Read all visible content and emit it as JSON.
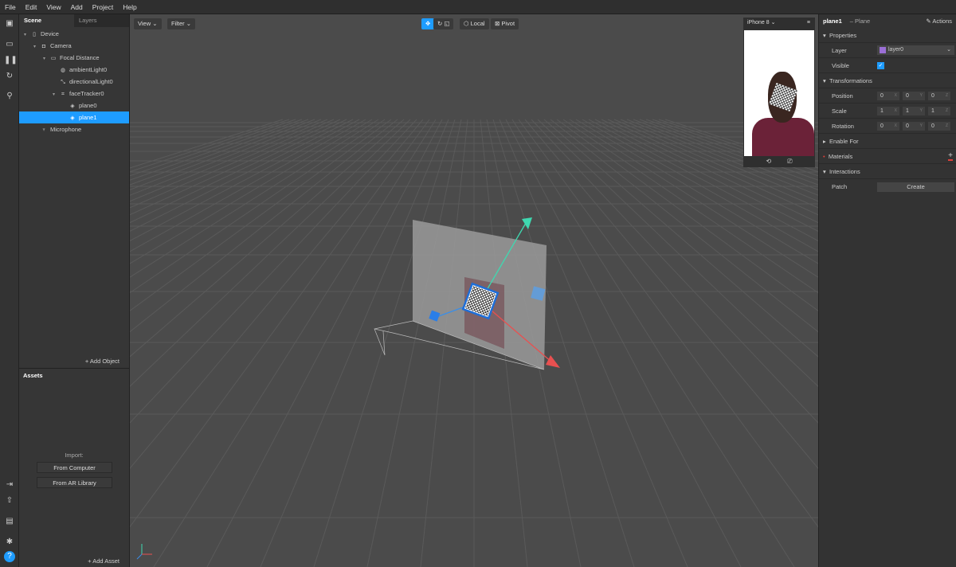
{
  "menu": [
    "File",
    "Edit",
    "View",
    "Add",
    "Project",
    "Help"
  ],
  "scene": {
    "tabs": [
      "Scene",
      "Layers"
    ],
    "tree": [
      {
        "label": "Device",
        "icon": "device-icon",
        "depth": 0,
        "arrow": true
      },
      {
        "label": "Camera",
        "icon": "camera-icon",
        "depth": 1,
        "arrow": true
      },
      {
        "label": "Focal Distance",
        "icon": "focal-distance-icon",
        "depth": 2,
        "arrow": true
      },
      {
        "label": "ambientLight0",
        "icon": "ambient-light-icon",
        "depth": 3,
        "arrow": false
      },
      {
        "label": "directionalLight0",
        "icon": "directional-light-icon",
        "depth": 3,
        "arrow": false
      },
      {
        "label": "faceTracker0",
        "icon": "face-tracker-icon",
        "depth": 3,
        "arrow": true
      },
      {
        "label": "plane0",
        "icon": "plane-icon",
        "depth": 4,
        "arrow": false
      },
      {
        "label": "plane1",
        "icon": "plane-icon",
        "depth": 4,
        "arrow": false,
        "selected": true
      },
      {
        "label": "Microphone",
        "icon": "microphone-icon",
        "depth": 1,
        "arrow": false
      }
    ],
    "add_object": "+  Add Object"
  },
  "assets": {
    "title": "Assets",
    "import": "Import:",
    "from_computer": "From Computer",
    "from_library": "From AR Library",
    "add_asset": "+  Add Asset"
  },
  "viewport": {
    "view": "View ⌄",
    "filter": "Filter ⌄",
    "local": "Local",
    "pivot": "Pivot",
    "device": "iPhone 8  ⌄"
  },
  "inspector": {
    "name": "plane1",
    "type": "– Plane",
    "actions": "Actions",
    "properties": "Properties",
    "layer_label": "Layer",
    "layer_value": "layer0",
    "visible_label": "Visible",
    "transformations": "Transformations",
    "position": {
      "label": "Position",
      "values": [
        "0",
        "0",
        "0"
      ]
    },
    "scale": {
      "label": "Scale",
      "values": [
        "1",
        "1",
        "1"
      ]
    },
    "rotation": {
      "label": "Rotation",
      "values": [
        "0",
        "0",
        "0"
      ]
    },
    "enable_for": "Enable For",
    "materials": "Materials",
    "interactions": "Interactions",
    "patch": "Patch",
    "create": "Create"
  },
  "colors": {
    "accent": "#1e9cff",
    "layer": "#9b6fd6",
    "warning": "#e0403a"
  }
}
